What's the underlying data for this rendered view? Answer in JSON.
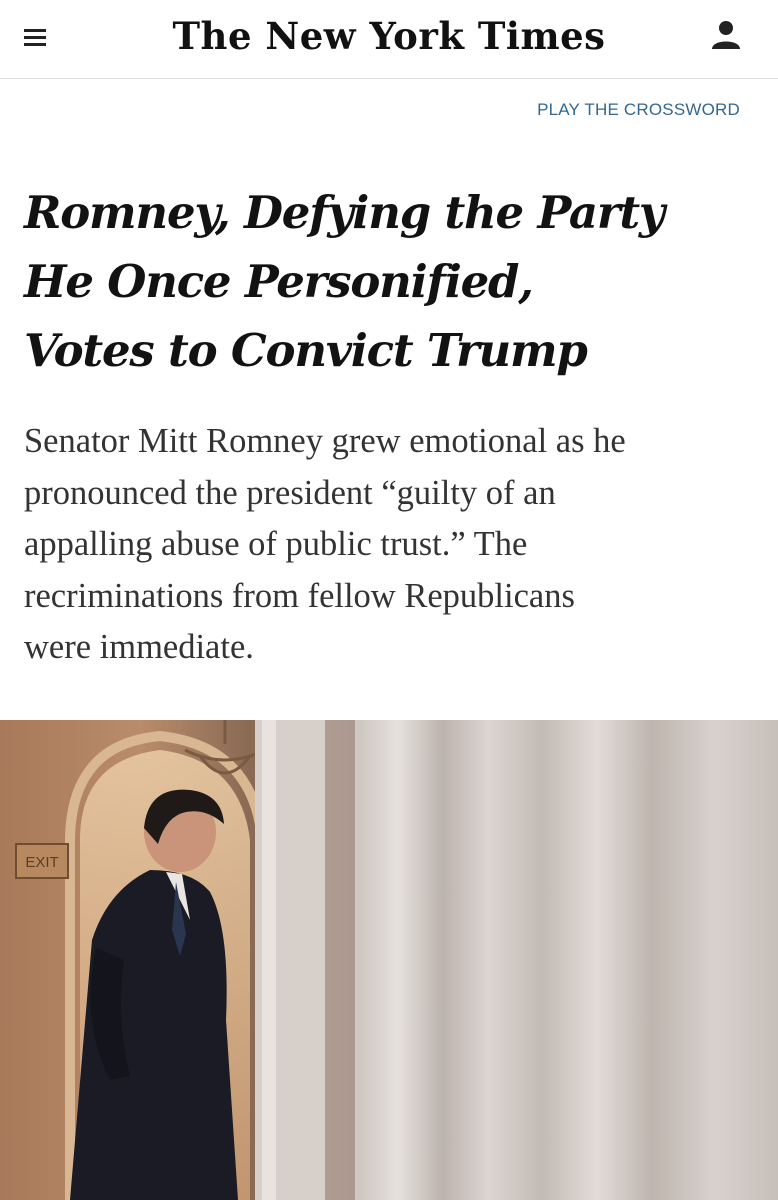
{
  "header": {
    "masthead": "The New York Times",
    "menu_icon": "hamburger-menu-icon",
    "account_icon": "user-account-icon"
  },
  "crossword_link": "PLAY THE CROSSWORD",
  "article": {
    "headline_lines": [
      "Romney, Defying the Party",
      "He Once Personified,",
      "Votes to Convict Trump"
    ],
    "summary_lines": [
      "Senator Mitt Romney grew emotional as he",
      "pronounced the president “guilty of an",
      "appalling abuse of public trust.” The",
      "recriminations from fellow Republicans",
      "were immediate."
    ],
    "photo_sign_text": "EXIT"
  },
  "colors": {
    "link": "#326891",
    "headline": "#121212",
    "summary": "#333333",
    "rule": "#dcdcdc"
  }
}
